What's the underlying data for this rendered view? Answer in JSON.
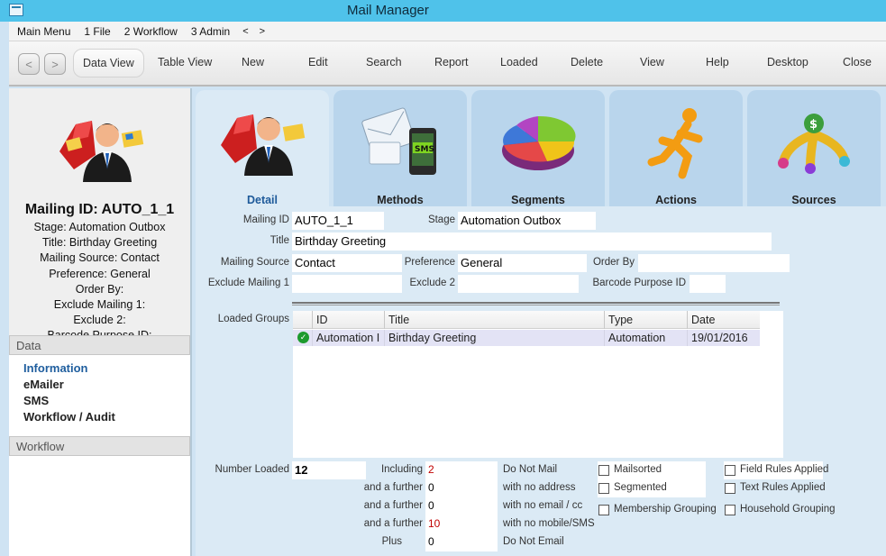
{
  "window": {
    "title": "Mail Manager"
  },
  "menu": {
    "items": [
      "Main Menu",
      "1 File",
      "2 Workflow",
      "3 Admin"
    ],
    "back": "<",
    "forward": ">"
  },
  "toolbar": {
    "nav_back": "<",
    "nav_forward": ">",
    "buttons": [
      "Data View",
      "Table View",
      "New",
      "Edit",
      "Search",
      "Report",
      "Loaded",
      "Delete",
      "View",
      "Help",
      "Desktop",
      "Close"
    ]
  },
  "left": {
    "mailing_id": "Mailing ID: AUTO_1_1",
    "summary": [
      "Stage: Automation Outbox",
      "Title: Birthday Greeting",
      "Mailing Source: Contact",
      "Preference: General",
      "Order By:",
      "Exclude Mailing 1:",
      "Exclude 2:",
      "Barcode Purpose ID:"
    ],
    "data_header": "Data",
    "data_links": [
      "Information",
      "eMailer",
      "SMS",
      "Workflow / Audit"
    ],
    "workflow_header": "Workflow"
  },
  "tabs": [
    "Detail",
    "Methods",
    "Segments",
    "Actions",
    "Sources"
  ],
  "form": {
    "mailing_id_label": "Mailing ID",
    "mailing_id": "AUTO_1_1",
    "stage_label": "Stage",
    "stage": "Automation Outbox",
    "title_label": "Title",
    "title": "Birthday Greeting",
    "source_label": "Mailing Source",
    "source": "Contact",
    "preference_label": "Preference",
    "preference": "General",
    "order_by_label": "Order By",
    "order_by": "",
    "exclude1_label": "Exclude Mailing 1",
    "exclude1": "",
    "exclude2_label": "Exclude 2",
    "exclude2": "",
    "barcode_label": "Barcode Purpose ID",
    "barcode": ""
  },
  "loaded_groups": {
    "label": "Loaded Groups",
    "columns": [
      "ID",
      "Title",
      "Type",
      "Date"
    ],
    "rows": [
      {
        "id": "Automation I",
        "title": "Birthday Greeting",
        "type": "Automation",
        "date": "19/01/2016"
      }
    ]
  },
  "counts": {
    "number_loaded_label": "Number Loaded",
    "number_loaded": "12",
    "lines": [
      {
        "prefix": "Including",
        "value": "2",
        "suffix": "Do Not Mail"
      },
      {
        "prefix": "and a further",
        "value": "0",
        "suffix": "with no address"
      },
      {
        "prefix": "and a further",
        "value": "0",
        "suffix": "with no email / cc"
      },
      {
        "prefix": "and a further",
        "value": "10",
        "suffix": "with no mobile/SMS"
      },
      {
        "prefix": "Plus",
        "value": "0",
        "suffix": "Do Not Email"
      }
    ]
  },
  "checkboxes": [
    "Mailsorted",
    "Segmented",
    "Membership Grouping",
    "Field Rules Applied",
    "Text Rules Applied",
    "Household Grouping"
  ]
}
